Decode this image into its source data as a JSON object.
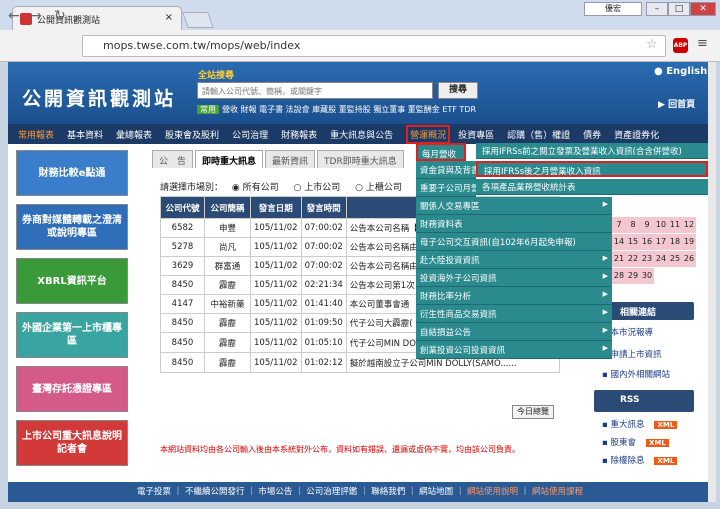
{
  "browser": {
    "tab_title": "公開資訊觀測站",
    "user": "優宏",
    "url": "mops.twse.com.tw/mops/web/index",
    "abp": "ABP"
  },
  "header": {
    "logo": "公開資訊觀測站",
    "search_label": "全站搜尋",
    "search_placeholder": "請輸入公司代號、簡稱，或關鍵字",
    "search_button": "搜尋",
    "hot_label": "常用",
    "hot_words": "營收 財報 電子書 法說會 庫藏股 董監持股 獨立董事 董監酬金 ETF TDR",
    "english": "English",
    "home": "回首頁"
  },
  "nav": [
    "常用報表",
    "基本資料",
    "彙總報表",
    "股東會及股利",
    "公司治理",
    "財務報表",
    "重大訊息與公告",
    "營運概況",
    "投資專區",
    "認購（售）權證",
    "債券",
    "資產證券化"
  ],
  "banners": [
    "財務比較e點通",
    "券商對媒體轉載之澄清或說明專區",
    "XBRL資訊平台",
    "外國企業第一上市櫃專區",
    "臺灣存託憑證專區",
    "上市公司重大訊息說明記者會"
  ],
  "subtabs": [
    "公　告",
    "即時重大訊息",
    "最新資訊",
    "TDR即時重大訊息"
  ],
  "filter": {
    "label": "請選擇市場別：",
    "options": [
      "所有公司",
      "上市公司",
      "上櫃公司",
      "興櫃"
    ]
  },
  "table": {
    "headers": [
      "公司代號",
      "公司簡稱",
      "發言日期",
      "發言時間",
      ""
    ],
    "rows": [
      [
        "6582",
        "申豐",
        "105/11/02",
        "07:00:02",
        "公告本公司名稱【"
      ],
      [
        "5278",
        "尚凡",
        "105/11/02",
        "07:00:02",
        "公告本公司名稱由"
      ],
      [
        "3629",
        "群富通",
        "105/11/02",
        "07:00:02",
        "公告本公司名稱由"
      ],
      [
        "8450",
        "霹靂",
        "105/11/02",
        "02:21:34",
        "公告本公司第1次"
      ],
      [
        "4147",
        "中裕新藥",
        "105/11/02",
        "01:41:40",
        "本公司董事會通"
      ],
      [
        "8450",
        "霹靂",
        "105/11/02",
        "01:09:50",
        "代子公司大霹靂("
      ],
      [
        "8450",
        "霹靂",
        "105/11/02",
        "01:05:10",
        "代子公司MIN DOLLY (SAMOA) LIMITED(名稱"
      ],
      [
        "8450",
        "霹靂",
        "105/11/02",
        "01:02:12",
        "擬於越南設立子公司MIN DOLLY(SAMO......"
      ]
    ],
    "close_button": "今日總覽"
  },
  "dropdown": {
    "main": [
      "每月營收",
      "資金貸與及背書",
      "重要子公司月營",
      "關係人交易專區",
      "財務資料表",
      "母子公司交互資訊(自102年6月起免申報)",
      "赴大陸投資資訊",
      "投資海外子公司資訊",
      "財務比率分析",
      "衍生性商品交易資訊",
      "自結損益公告",
      "創業投資公司投資資訊"
    ],
    "sub": [
      "採用IFRSs前之閱立發票及營業收入資訊(合含併營收)",
      "採用IFRSs後之月營業收入資訊",
      "各項產品業務營收統計表"
    ]
  },
  "calendar": {
    "rows": [
      [
        "",
        "",
        "",
        "",
        "",
        ""
      ],
      [
        "7",
        "8",
        "9",
        "10",
        "11",
        "12"
      ],
      [
        "14",
        "15",
        "16",
        "17",
        "18",
        "19"
      ],
      [
        "21",
        "22",
        "23",
        "24",
        "25",
        "26"
      ],
      [
        "28",
        "29",
        "30",
        "",
        "",
        ""
      ]
    ]
  },
  "right": {
    "links_title": "相關連結",
    "links": [
      "本市況報導",
      "申請上市資訊",
      "國內外相關網站"
    ],
    "rss_title": "RSS",
    "rss": [
      "重大訊息",
      "股東會",
      "除權除息"
    ],
    "xml": "XML"
  },
  "footnote": "本網站資料均由各公司輸入後由本系統對外公布，資料如有錯誤、遺漏或虛偽不實，均由該公司負責。",
  "footer": {
    "items": [
      "電子投票",
      "不繼續公開發行",
      "市場公告",
      "公司治理評鑑",
      "聯絡我們",
      "網站地圖"
    ],
    "orange": [
      "網站使用說明",
      "網站使用課程"
    ]
  }
}
